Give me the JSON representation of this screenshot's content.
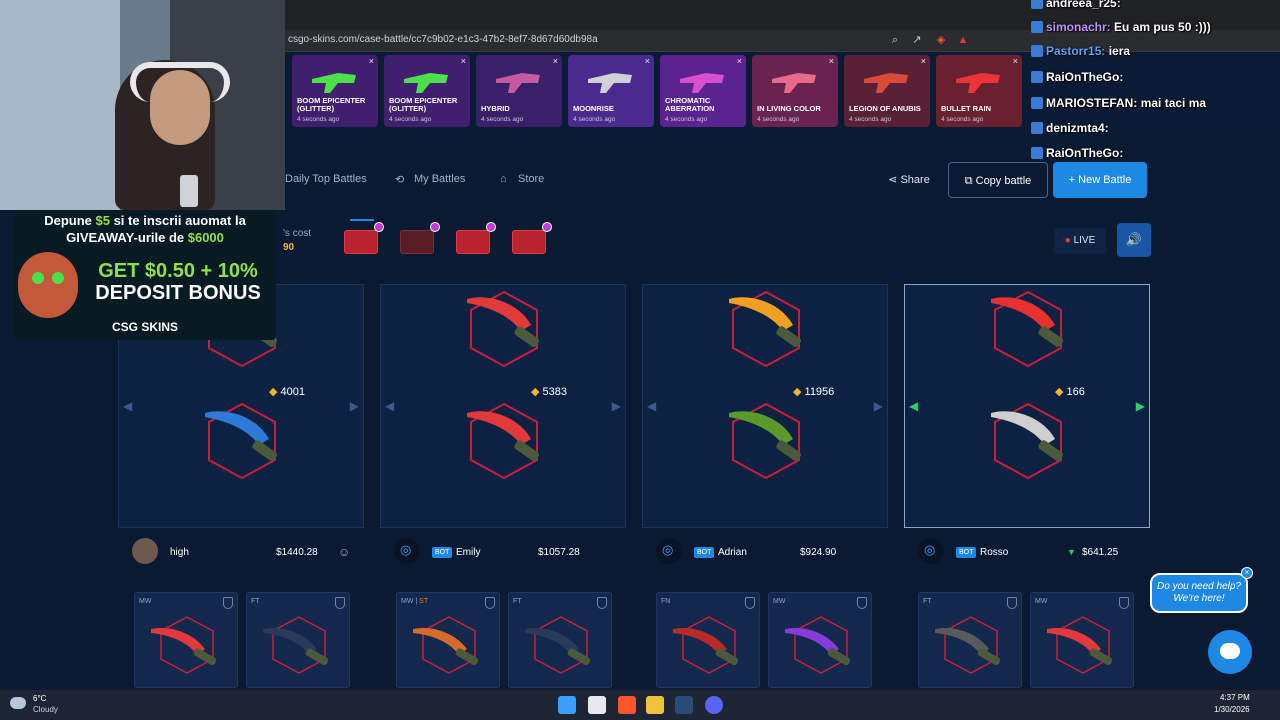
{
  "browser": {
    "url": "csgo-skins.com/case-battle/cc7c9b02-e1c3-47b2-8ef7-8d67d60db98a"
  },
  "live_drops": [
    {
      "name": "BOOM EPICENTER (GLITTER)",
      "time": "4 seconds ago",
      "color": "#3f1f6e",
      "accent": "#4de04a"
    },
    {
      "name": "BOOM EPICENTER (GLITTER)",
      "time": "4 seconds ago",
      "color": "#3f1f6e",
      "accent": "#4de04a"
    },
    {
      "name": "HYBRID",
      "time": "4 seconds ago",
      "color": "#3a1f6b",
      "accent": "#c45aa0"
    },
    {
      "name": "MOONRISE",
      "time": "4 seconds ago",
      "color": "#4a2a8e",
      "accent": "#d0d0d6"
    },
    {
      "name": "CHROMATIC ABERRATION",
      "time": "4 seconds ago",
      "color": "#5a2390",
      "accent": "#d84fd0"
    },
    {
      "name": "IN LIVING COLOR",
      "time": "4 seconds ago",
      "color": "#6a2350",
      "accent": "#e86a8a"
    },
    {
      "name": "LEGION OF ANUBIS",
      "time": "4 seconds ago",
      "color": "#5a2036",
      "accent": "#d94a3a"
    },
    {
      "name": "BULLET RAIN",
      "time": "4 seconds ago",
      "color": "#6b2030",
      "accent": "#e8343a"
    }
  ],
  "nav": {
    "daily_top": "Daily Top Battles",
    "my_battles": "My Battles",
    "store": "Store",
    "share": "Share",
    "copy": "Copy battle",
    "new": "+ New Battle",
    "live": "LIVE",
    "cost_label": "'s cost",
    "cost_value": "90"
  },
  "columns": [
    {
      "value": "4001",
      "colors": [
        "#e8d85a",
        "#2d7bd8"
      ]
    },
    {
      "value": "5383",
      "colors": [
        "#e23a3a",
        "#e23a3a"
      ]
    },
    {
      "value": "11956",
      "colors": [
        "#f0a020",
        "#5a9a2a"
      ]
    },
    {
      "value": "166",
      "colors": [
        "#e83030",
        "#cfcfcf"
      ]
    }
  ],
  "players": [
    {
      "name": "high",
      "bot": "",
      "value": "$1440.28"
    },
    {
      "name": "Emily",
      "bot": "BOT",
      "value": "$1057.28"
    },
    {
      "name": "Adrian",
      "bot": "BOT",
      "value": "$924.90"
    },
    {
      "name": "Rosso",
      "bot": "BOT",
      "value": "$641.25"
    }
  ],
  "items": [
    {
      "wear": "MW",
      "st": ""
    },
    {
      "wear": "FT",
      "st": ""
    },
    {
      "wear": "MW",
      "st": "ST"
    },
    {
      "wear": "FT",
      "st": ""
    },
    {
      "wear": "FN",
      "st": ""
    },
    {
      "wear": "MW",
      "st": ""
    },
    {
      "wear": "FT",
      "st": ""
    },
    {
      "wear": "MW",
      "st": ""
    }
  ],
  "promo": {
    "line1a": "Depune ",
    "line1b": "$5",
    "line1c": " si te inscrii auomat la",
    "line2a": "GIVEAWAY-urile de ",
    "line2b": "$6000",
    "bonus1": "GET $0.50 + 10%",
    "bonus2": "DEPOSIT BONUS",
    "brand": "CSG SKINS"
  },
  "chat": [
    {
      "user": "andreea_r25:",
      "msg": "",
      "ucolor": "#ffffff"
    },
    {
      "user": "simonachr:",
      "msg": "Eu am pus 50 :)))",
      "ucolor": "#c58fff"
    },
    {
      "user": "Pastorr15:",
      "msg": "iera",
      "ucolor": "#5aa0ff"
    },
    {
      "user": "RaiOnTheGo:",
      "msg": "",
      "ucolor": "#ffffff"
    },
    {
      "user": "MARIOSTEFAN:",
      "msg": "mai taci ma",
      "ucolor": "#ffffff"
    },
    {
      "user": "denizmta4:",
      "msg": "",
      "ucolor": "#ffffff"
    },
    {
      "user": "RaiOnTheGo:",
      "msg": "",
      "ucolor": "#ffffff"
    }
  ],
  "help": {
    "line1": "Do you need help?",
    "line2": "We're here!"
  },
  "taskbar": {
    "temp": "6°C",
    "weather": "Cloudy",
    "time": "4:37 PM",
    "date": "1/30/2026"
  }
}
